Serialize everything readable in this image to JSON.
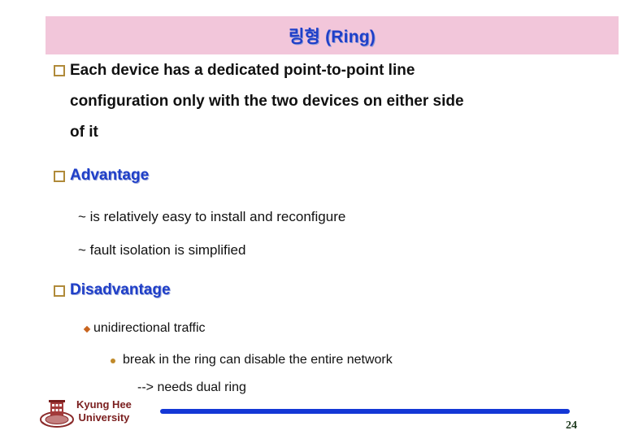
{
  "slide": {
    "title": "링형 (Ring)",
    "intro": {
      "lines": [
        "Each device has a dedicated point-to-point line",
        "configuration only with the two devices on either side",
        "of it"
      ]
    },
    "advantage": {
      "heading": "Advantage",
      "items": [
        "~ is relatively easy to install and reconfigure",
        "~ fault isolation is simplified"
      ]
    },
    "disadvantage": {
      "heading": "Disadvantage",
      "items": [
        "unidirectional traffic"
      ],
      "subitems": [
        "break in the ring can disable the entire network",
        "--> needs dual ring"
      ]
    }
  },
  "footer": {
    "university_line1": "Kyung Hee",
    "university_line2": "University",
    "page_number": "24",
    "logo_icon": "university-seal-icon"
  },
  "colors": {
    "title_bg": "#f2c6da",
    "heading_blue": "#1f3fc8",
    "bullet_box": "#b08a3a",
    "footer_line": "#1437d6",
    "university_text": "#7a1e1e"
  }
}
